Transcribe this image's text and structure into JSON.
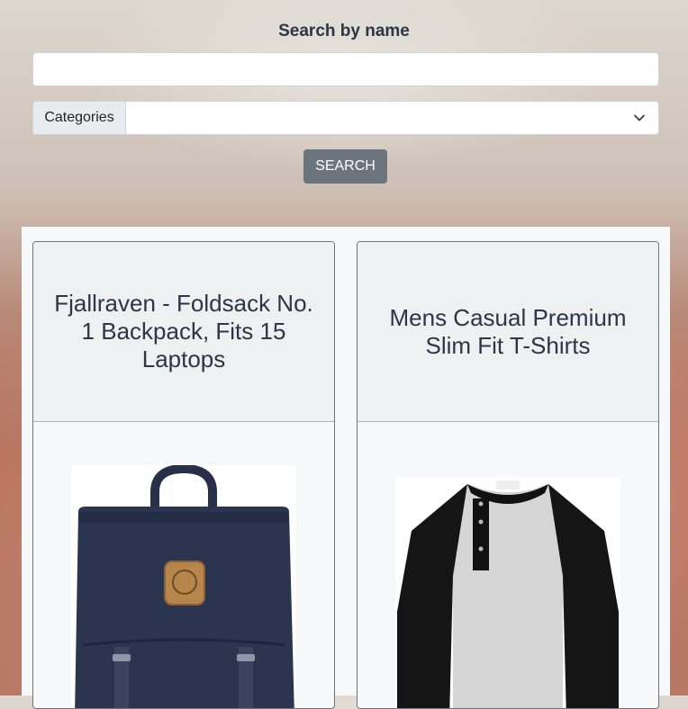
{
  "search": {
    "title": "Search by name",
    "name_value": "",
    "categories_label": "Categories",
    "categories_selected": "",
    "button_label": "SEARCH"
  },
  "products": [
    {
      "title": "Fjallraven - Foldsack No. 1 Backpack, Fits 15 Laptops",
      "image": "backpack-image"
    },
    {
      "title": "Mens Casual Premium Slim Fit T-Shirts",
      "image": "tshirt-image"
    }
  ],
  "colors": {
    "button": "#6c757d",
    "text": "#2b3646",
    "backpack": "#2c3550",
    "badge": "#b7864c"
  }
}
